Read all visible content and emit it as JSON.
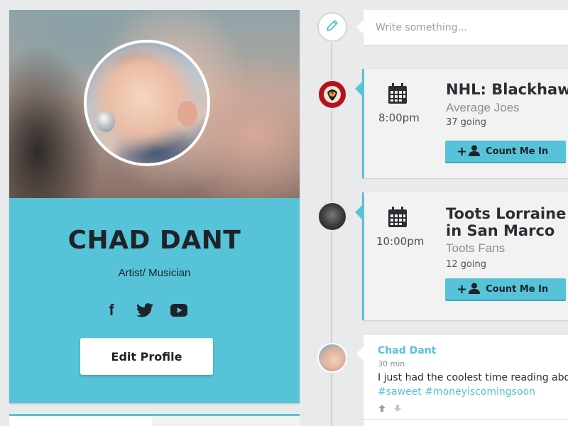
{
  "profile": {
    "name": "CHAD DANT",
    "role": "Artist/ Musician",
    "social": {
      "facebook_glyph": "f",
      "facebook": "facebook-icon",
      "twitter": "twitter-icon",
      "youtube": "youtube-icon"
    },
    "edit_button": "Edit Profile"
  },
  "composer": {
    "placeholder": "Write something..."
  },
  "events": [
    {
      "time": "8:00pm",
      "title_lines": [
        "NHL: Blackhawks"
      ],
      "host": "Average Joes",
      "going": "37 going",
      "button": "Count Me In"
    },
    {
      "time": "10:00pm",
      "title_lines": [
        "Toots Lorraine @",
        "in San Marco"
      ],
      "host": "Toots Fans",
      "going": "12 going",
      "button": "Count Me In"
    }
  ],
  "post": {
    "author": "Chad Dant",
    "time": "30 min",
    "text": "I just had the coolest time reading about",
    "tags": "#saweet #moneyiscomingsoon"
  },
  "colors": {
    "accent": "#56c3d9",
    "background": "#e9eaeb",
    "dark_text": "#1e2327"
  }
}
